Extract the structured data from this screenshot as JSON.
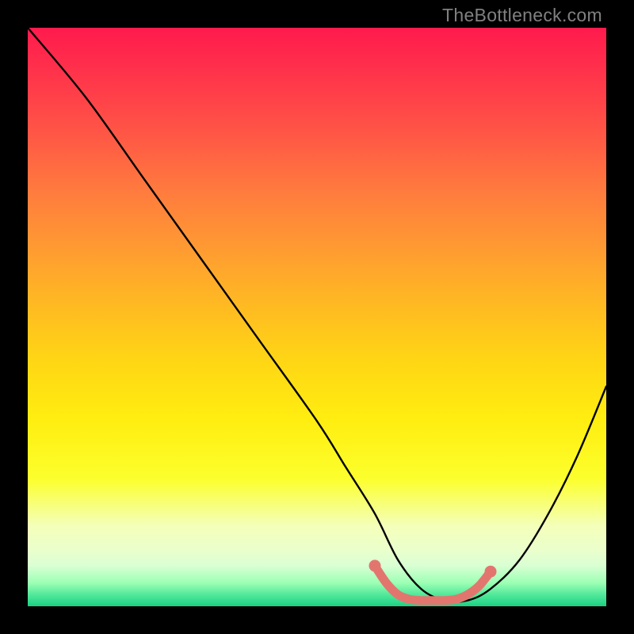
{
  "watermark": "TheBottleneck.com",
  "chart_data": {
    "type": "line",
    "title": "",
    "xlabel": "",
    "ylabel": "",
    "xlim": [
      0,
      100
    ],
    "ylim": [
      0,
      100
    ],
    "series": [
      {
        "name": "bottleneck-curve",
        "x": [
          0,
          10,
          20,
          30,
          40,
          50,
          55,
          60,
          64,
          68,
          72,
          76,
          80,
          85,
          90,
          95,
          100
        ],
        "y": [
          100,
          88,
          74,
          60,
          46,
          32,
          24,
          16,
          8,
          3,
          1,
          1,
          3,
          8,
          16,
          26,
          38
        ]
      }
    ],
    "highlight_segment": {
      "name": "optimal-range",
      "color": "#e2766f",
      "x": [
        60,
        62,
        64,
        66,
        68,
        70,
        72,
        74,
        76,
        78,
        80
      ],
      "y": [
        7,
        4,
        2,
        1.2,
        1,
        1,
        1,
        1.2,
        2,
        3.5,
        6
      ]
    },
    "highlight_endpoints": {
      "color": "#e2766f",
      "points": [
        {
          "x": 60,
          "y": 7
        },
        {
          "x": 80,
          "y": 6
        }
      ]
    }
  }
}
